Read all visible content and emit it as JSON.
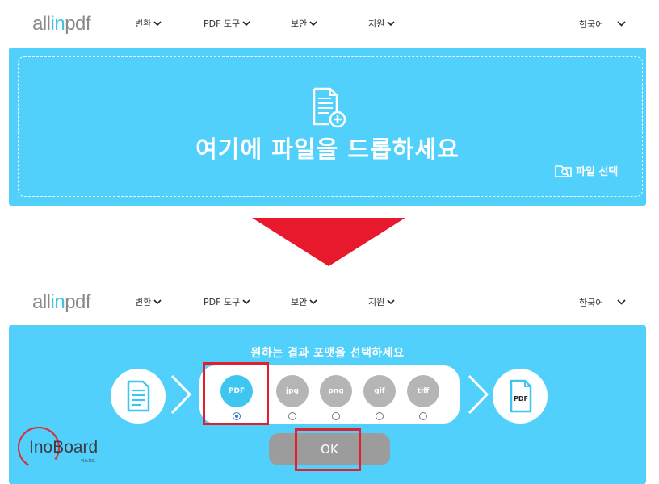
{
  "header": {
    "logo_prefix": "all",
    "logo_accent": "in",
    "logo_suffix": "pdf",
    "nav": [
      "변환",
      "PDF 도구",
      "보안",
      "지원"
    ],
    "language": "한국어"
  },
  "dropzone": {
    "message": "여기에 파일을 드롭하세요",
    "choose_file_label": "파일 선택"
  },
  "format_panel": {
    "title": "원하는 결과 포맷을 선택하세요",
    "formats": [
      "PDF",
      "jpg",
      "png",
      "gif",
      "tiff"
    ],
    "selected_format": "PDF",
    "result_icon_label": "PDF",
    "ok_label": "OK"
  },
  "watermark": {
    "brand": "InoBoard",
    "sub": "이노보드"
  },
  "colors": {
    "panel_blue": "#51d0fb",
    "accent_cyan": "#3fc4e8",
    "selected_format": "#3ec6f0",
    "unselected_format": "#b5b5b5",
    "arrow_red": "#e8192c",
    "highlight_red": "#e0202e",
    "ok_button": "#9c9c9c"
  },
  "icons": [
    "chevron-down-icon",
    "file-add-icon",
    "folder-search-icon",
    "document-icon",
    "pdf-file-icon",
    "chevron-right-icon",
    "down-arrow-icon"
  ]
}
